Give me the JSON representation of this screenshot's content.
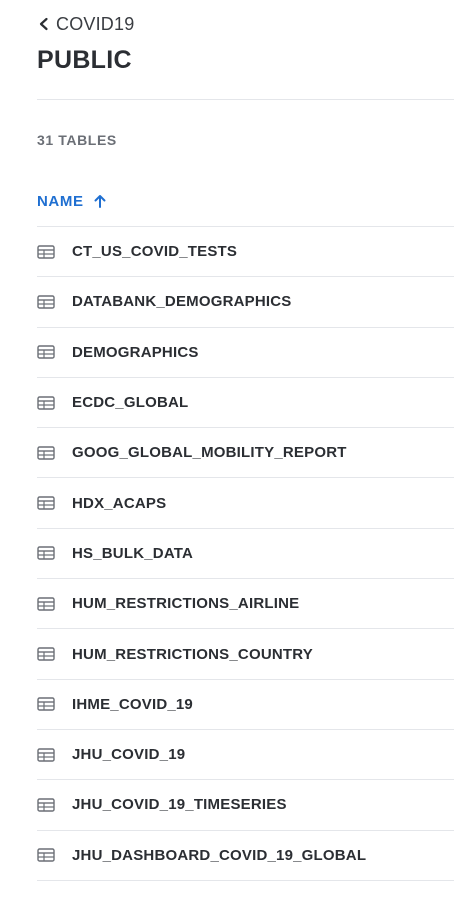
{
  "nav": {
    "back_label": "COVID19"
  },
  "page": {
    "title": "PUBLIC",
    "table_count": "31 TABLES"
  },
  "sort": {
    "label": "NAME",
    "direction": "ascending"
  },
  "colors": {
    "accent": "#1f6fd1",
    "text": "#2b2e33",
    "muted": "#6b6f76",
    "divider": "#e4e6ea"
  },
  "tables": [
    {
      "name": "CT_US_COVID_TESTS",
      "icon": "table-icon"
    },
    {
      "name": "DATABANK_DEMOGRAPHICS",
      "icon": "table-icon"
    },
    {
      "name": "DEMOGRAPHICS",
      "icon": "table-icon"
    },
    {
      "name": "ECDC_GLOBAL",
      "icon": "table-icon"
    },
    {
      "name": "GOOG_GLOBAL_MOBILITY_REPORT",
      "icon": "table-icon"
    },
    {
      "name": "HDX_ACAPS",
      "icon": "table-icon"
    },
    {
      "name": "HS_BULK_DATA",
      "icon": "table-icon"
    },
    {
      "name": "HUM_RESTRICTIONS_AIRLINE",
      "icon": "table-icon"
    },
    {
      "name": "HUM_RESTRICTIONS_COUNTRY",
      "icon": "table-icon"
    },
    {
      "name": "IHME_COVID_19",
      "icon": "table-icon"
    },
    {
      "name": "JHU_COVID_19",
      "icon": "table-icon"
    },
    {
      "name": "JHU_COVID_19_TIMESERIES",
      "icon": "table-icon"
    },
    {
      "name": "JHU_DASHBOARD_COVID_19_GLOBAL",
      "icon": "table-icon"
    }
  ]
}
